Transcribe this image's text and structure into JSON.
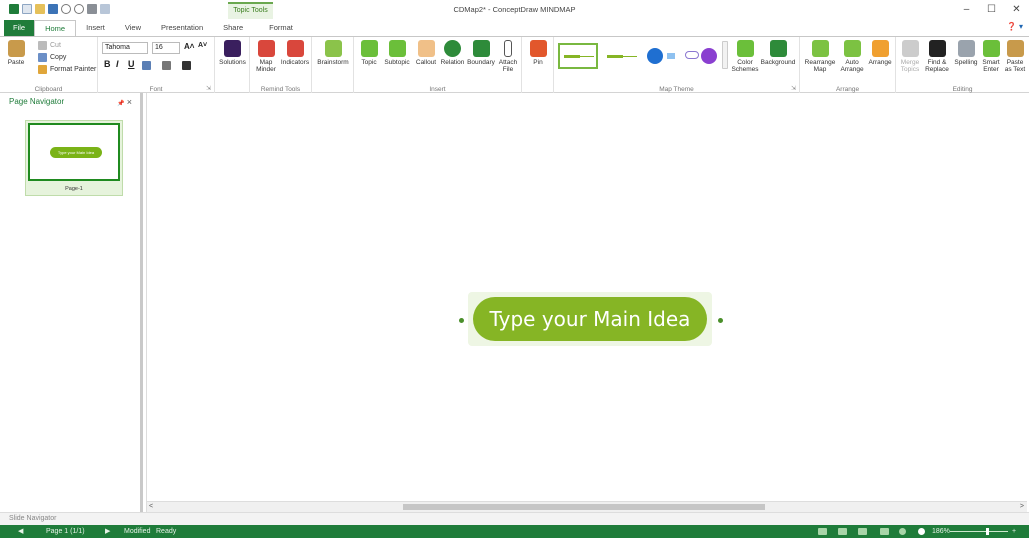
{
  "window": {
    "title": "CDMap2* - ConceptDraw MINDMAP",
    "contextual_tab": "Topic Tools",
    "controls": {
      "minimize": "–",
      "maximize": "☐",
      "close": "✕"
    },
    "help": "❓ ▾"
  },
  "tabs": [
    "File",
    "Home",
    "Insert",
    "View",
    "Presentation",
    "Share",
    "Format"
  ],
  "active_tab": "Home",
  "ribbon": {
    "clipboard": {
      "paste": "Paste",
      "cut": "Cut",
      "copy": "Copy",
      "format_painter": "Format Painter",
      "label": "Clipboard"
    },
    "font": {
      "family": "Tahoma",
      "size": "16",
      "grow": "A˄",
      "shrink": "A˅",
      "bold": "B",
      "italic": "I",
      "underline": "U",
      "label": "Font"
    },
    "solutions": {
      "label": "Solutions"
    },
    "remind_tools": {
      "map_minder": "Map Minder",
      "indicators": "Indicators",
      "label": "Remind Tools"
    },
    "brainstorm": {
      "label": "Brainstorm"
    },
    "insert": {
      "topic": "Topic",
      "subtopic": "Subtopic",
      "callout": "Callout",
      "relation": "Relation",
      "boundary": "Boundary",
      "attach_file": "Attach File",
      "label": "Insert"
    },
    "pin": {
      "label": "Pin"
    },
    "map_theme": {
      "label": "Map Theme",
      "color_schemes": "Color Schemes",
      "background": "Background"
    },
    "arrange": {
      "rearrange_map": "Rearrange Map",
      "auto_arrange": "Auto Arrange",
      "arrange": "Arrange",
      "label": "Arrange"
    },
    "editing": {
      "merge_topics": "Merge Topics",
      "find_replace": "Find & Replace",
      "spelling": "Spelling",
      "smart_enter": "Smart Enter",
      "paste_as_text": "Paste as Text",
      "label": "Editing"
    }
  },
  "navigator": {
    "title": "Page Navigator",
    "pin": "📌",
    "close": "×",
    "page_label": "Page-1",
    "thumb_topic": "Type your Main Idea"
  },
  "canvas": {
    "main_topic": "Type your Main Idea"
  },
  "slide_navigator": "Slide Navigator",
  "status": {
    "page": "Page 1 (1/1)",
    "modified": "Modified",
    "ready": "Ready",
    "zoom": "186%"
  },
  "colors": {
    "accent_green": "#1f7c3a",
    "topic_green": "#86b525"
  }
}
